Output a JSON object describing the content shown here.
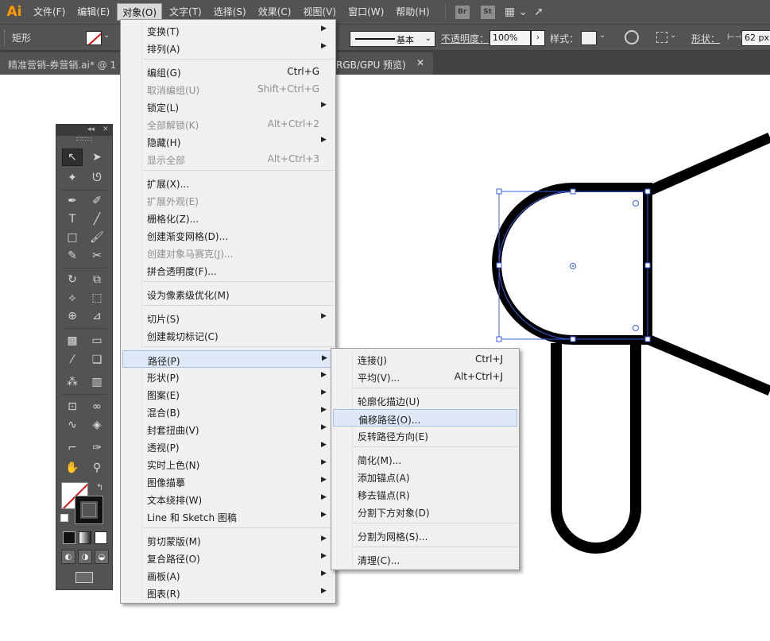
{
  "app": {
    "logo": "Ai"
  },
  "menubar": {
    "items": [
      "文件(F)",
      "编辑(E)",
      "对象(O)",
      "文字(T)",
      "选择(S)",
      "效果(C)",
      "视图(V)",
      "窗口(W)",
      "帮助(H)"
    ],
    "active_index": 2,
    "badges": [
      "Br",
      "St"
    ]
  },
  "controlbar": {
    "shape_label": "矩形",
    "stroke_style": "基本",
    "opacity_label": "不透明度：",
    "opacity_value": "100%",
    "style_label": "样式：",
    "shape_prop_label": "形状：",
    "width_value": "62 px"
  },
  "document_tab": {
    "title": "精准营销-券营销.ai* @ 1",
    "title_end": "RGB/GPU 预览)",
    "close": "✕"
  },
  "object_menu": {
    "items": [
      {
        "label": "变换(T)",
        "submenu": true
      },
      {
        "label": "排列(A)",
        "submenu": true
      },
      {
        "sep": true
      },
      {
        "label": "编组(G)",
        "shortcut": "Ctrl+G"
      },
      {
        "label": "取消编组(U)",
        "shortcut": "Shift+Ctrl+G",
        "disabled": true
      },
      {
        "label": "锁定(L)",
        "submenu": true
      },
      {
        "label": "全部解锁(K)",
        "shortcut": "Alt+Ctrl+2",
        "disabled": true
      },
      {
        "label": "隐藏(H)",
        "submenu": true
      },
      {
        "label": "显示全部",
        "shortcut": "Alt+Ctrl+3",
        "disabled": true
      },
      {
        "sep": true
      },
      {
        "label": "扩展(X)..."
      },
      {
        "label": "扩展外观(E)",
        "disabled": true
      },
      {
        "label": "栅格化(Z)..."
      },
      {
        "label": "创建渐变网格(D)..."
      },
      {
        "label": "创建对象马赛克(J)...",
        "disabled": true
      },
      {
        "label": "拼合透明度(F)..."
      },
      {
        "sep": true
      },
      {
        "label": "设为像素级优化(M)"
      },
      {
        "sep": true
      },
      {
        "label": "切片(S)",
        "submenu": true
      },
      {
        "label": "创建裁切标记(C)"
      },
      {
        "sep": true
      },
      {
        "label": "路径(P)",
        "submenu": true,
        "highlighted": true
      },
      {
        "label": "形状(P)",
        "submenu": true
      },
      {
        "label": "图案(E)",
        "submenu": true
      },
      {
        "label": "混合(B)",
        "submenu": true
      },
      {
        "label": "封套扭曲(V)",
        "submenu": true
      },
      {
        "label": "透视(P)",
        "submenu": true
      },
      {
        "label": "实时上色(N)",
        "submenu": true
      },
      {
        "label": "图像描摹",
        "submenu": true
      },
      {
        "label": "文本绕排(W)",
        "submenu": true
      },
      {
        "label": "Line 和 Sketch 图稿",
        "submenu": true
      },
      {
        "sep": true
      },
      {
        "label": "剪切蒙版(M)",
        "submenu": true
      },
      {
        "label": "复合路径(O)",
        "submenu": true
      },
      {
        "label": "画板(A)",
        "submenu": true
      },
      {
        "label": "图表(R)",
        "submenu": true
      }
    ]
  },
  "path_submenu": {
    "items": [
      {
        "label": "连接(J)",
        "shortcut": "Ctrl+J"
      },
      {
        "label": "平均(V)...",
        "shortcut": "Alt+Ctrl+J"
      },
      {
        "sep": true
      },
      {
        "label": "轮廓化描边(U)"
      },
      {
        "label": "偏移路径(O)...",
        "highlighted": true
      },
      {
        "label": "反转路径方向(E)"
      },
      {
        "sep": true
      },
      {
        "label": "简化(M)..."
      },
      {
        "label": "添加锚点(A)"
      },
      {
        "label": "移去锚点(R)"
      },
      {
        "label": "分割下方对象(D)"
      },
      {
        "sep": true
      },
      {
        "label": "分割为网格(S)..."
      },
      {
        "sep": true
      },
      {
        "label": "清理(C)..."
      }
    ]
  }
}
